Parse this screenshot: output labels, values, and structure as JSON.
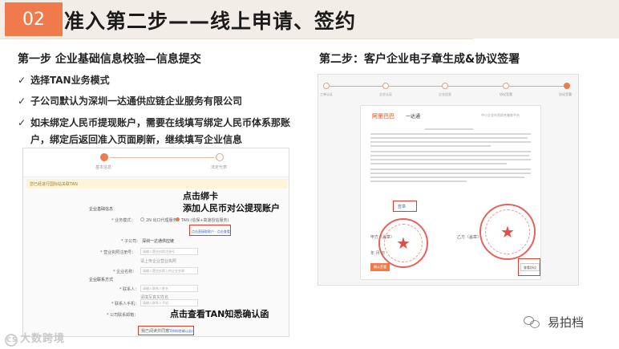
{
  "header": {
    "number": "02",
    "title": "准入第二步——线上申请、签约"
  },
  "left": {
    "step_title": "第一步 企业基础信息校验—信息提交",
    "bullets": [
      "选择TAN业务模式",
      "子公司默认为深圳一达通供应链企业服务有限公司",
      "如未绑定人民币提现账户，需要在线填写绑定人民币体系那账",
      "户，绑定后返回准入页面刷新，继续填写企业信息"
    ]
  },
  "right": {
    "step_title": "第二步：客户企业电子章生成&协议签署"
  },
  "shot_left": {
    "progress_labels": [
      "基本信息",
      "法定代表"
    ],
    "notice": "您已经进行国际站关联TAN",
    "section_basic": "企业基础信息",
    "field_mode_label": "* 业务模式：",
    "mode_option_a": "2N 出口代理服务",
    "mode_option_b": "TAN (信保+高速授信服务)",
    "mode_link": "点击直接取款户 · 点击查看",
    "field_company_label": "* 子公司：",
    "field_company_value": "深圳一达通供应链",
    "field_reg_label": "* 营业执照注册号：",
    "field_reg_placeholder": "请输入营业执照注册号",
    "field_hint": "请上传企业营业执照",
    "field_name_label": "* 企业名称：",
    "field_name_placeholder": "请输入营业执照上的企业名称",
    "section_contact": "企业联系方式",
    "field_contact_label": "* 联系人：",
    "field_contact_placeholder": "请输入联系人姓名",
    "field_contact_hint": "请填写真实姓名",
    "field_phone_label": "* 联系人手机：",
    "field_phone_placeholder": "请输入联系人手机",
    "field_email_label": "* 公司联系邮箱：",
    "agree_label": "我已阅读并同意",
    "agree_link": "《TAN知悉确认函》",
    "callout_bind": [
      "点击绑卡",
      "添加人民币对公提现账户"
    ],
    "callout_tan": "点击查看TAN知悉确认函"
  },
  "shot_right": {
    "steps": [
      "工单认证",
      "企业认证",
      "企业信息",
      "协议签署",
      "协议签署"
    ],
    "logo_text": "阿里巴巴",
    "logo_sub": "一达通",
    "doc_header": "中小企业外贸综合服务平台",
    "stamp_btn": "签章",
    "party_a": "甲方（盖章）",
    "party_b": "乙方（盖章）",
    "btn_confirm": "确认签署",
    "btn_view": "查看协议",
    "date_text": "年 月 日"
  },
  "watermarks": {
    "left": "大数跨境",
    "left_mark": "CS",
    "right": "易拍档"
  },
  "colors": {
    "accent": "#ef7b4c",
    "highlight_box": "#e23b2a",
    "header_band": "#f3ede8"
  }
}
